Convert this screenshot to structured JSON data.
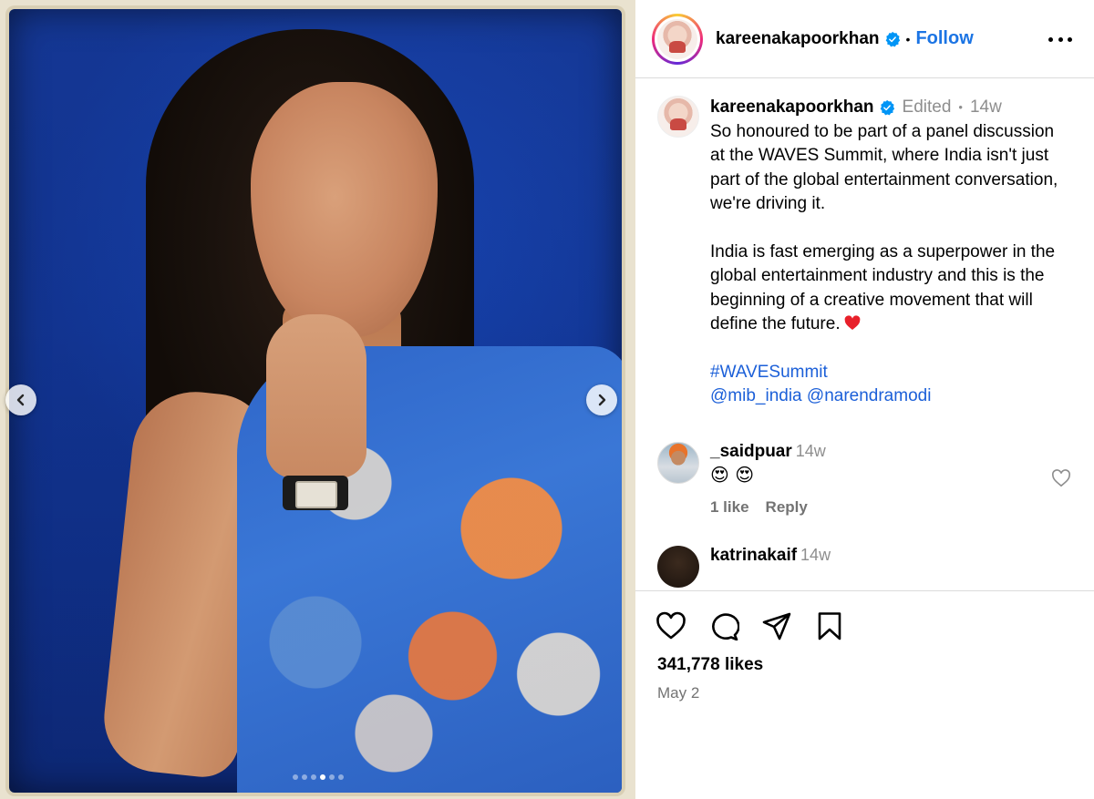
{
  "post": {
    "carousel": {
      "slide_count": 6,
      "active_index": 3
    }
  },
  "header": {
    "username": "kareenakapoorkhan",
    "separator": "•",
    "follow_label": "Follow"
  },
  "caption": {
    "username": "kareenakapoorkhan",
    "edited_label": "Edited",
    "separator": "•",
    "time": "14w",
    "paragraph1": "So honoured to be part of a panel discussion at the WAVES Summit, where India isn't just part of the global entertainment conversation, we're driving it.",
    "paragraph2": "India is fast emerging as a superpower in the global entertainment industry and this is the beginning of a creative movement that will define the future.",
    "hashtag": "#WAVESummit",
    "mention1": "@mib_india",
    "mention2": "@narendramodi"
  },
  "comments": [
    {
      "username": "_saidpuar",
      "time": "14w",
      "text": "😍 😍",
      "likes_label": "1 like",
      "reply_label": "Reply"
    },
    {
      "username": "katrinakaif",
      "time": "14w"
    }
  ],
  "footer": {
    "likes": "341,778 likes",
    "date": "May 2"
  },
  "colors": {
    "follow": "#1b74e4",
    "link": "#1b5fd8",
    "verified": "#0095f6",
    "heart": "#ed4956"
  },
  "icons": {
    "like": "heart-icon",
    "comment": "comment-icon",
    "share": "share-icon",
    "save": "bookmark-icon",
    "more": "more-options-icon",
    "prev": "chevron-left-icon",
    "next": "chevron-right-icon"
  }
}
